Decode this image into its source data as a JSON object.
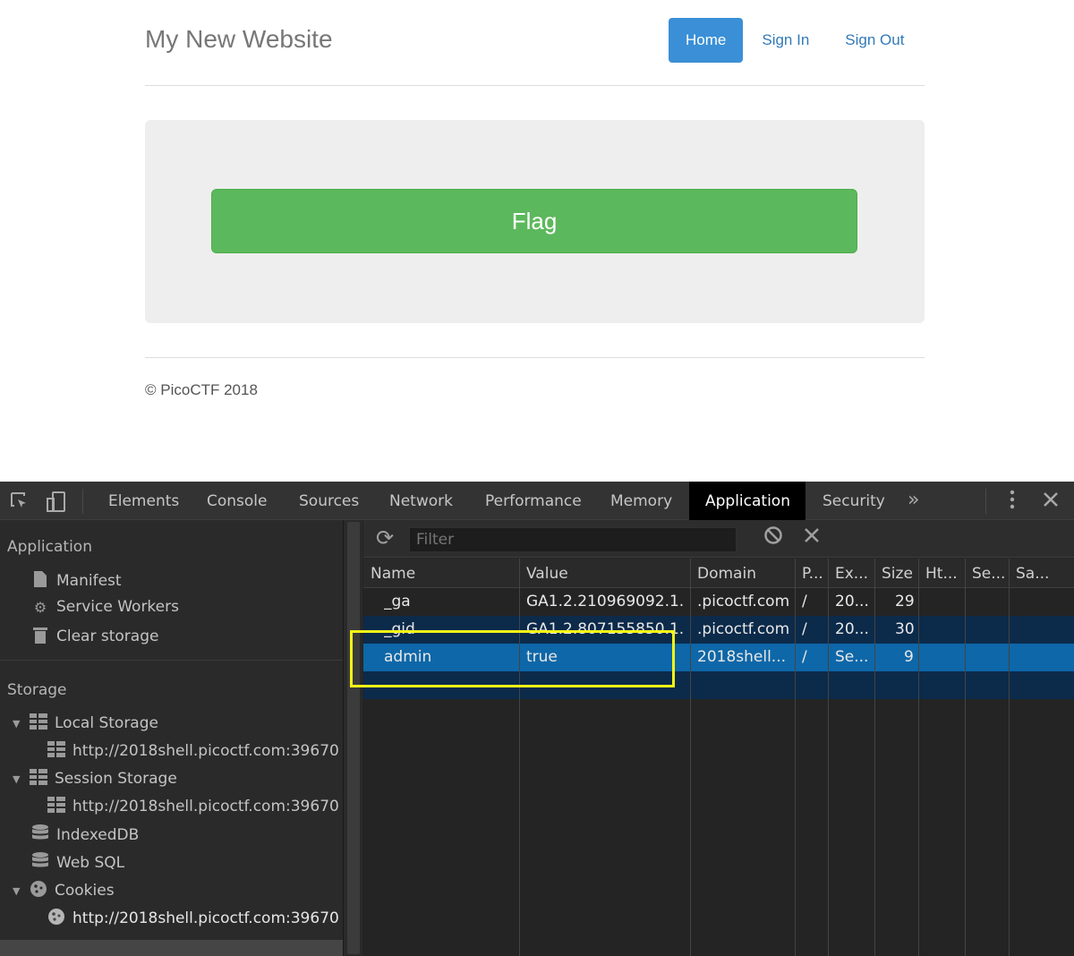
{
  "site": {
    "brand": "My New Website",
    "nav": [
      "Home",
      "Sign In",
      "Sign Out"
    ],
    "flag_button": "Flag",
    "footer": "© PicoCTF 2018",
    "colors": {
      "active_nav": "#3a8fd6",
      "flag_button": "#5cb85c",
      "link": "#337ab7"
    }
  },
  "devtools": {
    "tabs": [
      "Elements",
      "Console",
      "Sources",
      "Network",
      "Performance",
      "Memory",
      "Application",
      "Security"
    ],
    "active_tab": "Application",
    "sidebar": {
      "application_heading": "Application",
      "application_items": [
        "Manifest",
        "Service Workers",
        "Clear storage"
      ],
      "storage_heading": "Storage",
      "local_storage": "Local Storage",
      "local_storage_origin": "http://2018shell.picoctf.com:39670",
      "session_storage": "Session Storage",
      "session_storage_origin": "http://2018shell.picoctf.com:39670",
      "indexeddb": "IndexedDB",
      "websql": "Web SQL",
      "cookies": "Cookies",
      "cookies_origin": "http://2018shell.picoctf.com:39670"
    },
    "filter_placeholder": "Filter",
    "columns": [
      "Name",
      "Value",
      "Domain",
      "P...",
      "Ex...",
      "Size",
      "Ht...",
      "Se...",
      "Sa..."
    ],
    "cookies": [
      {
        "name": "_ga",
        "value": "GA1.2.210969092.1...",
        "domain": ".picoctf.com",
        "path": "/",
        "expires": "20...",
        "size": "29"
      },
      {
        "name": "_gid",
        "value": "GA1.2.807155850.1...",
        "domain": ".picoctf.com",
        "path": "/",
        "expires": "20...",
        "size": "30"
      },
      {
        "name": "admin",
        "value": "true",
        "domain": "2018shell....",
        "path": "/",
        "expires": "Se...",
        "size": "9"
      }
    ],
    "highlight_color": "#f5f516"
  }
}
